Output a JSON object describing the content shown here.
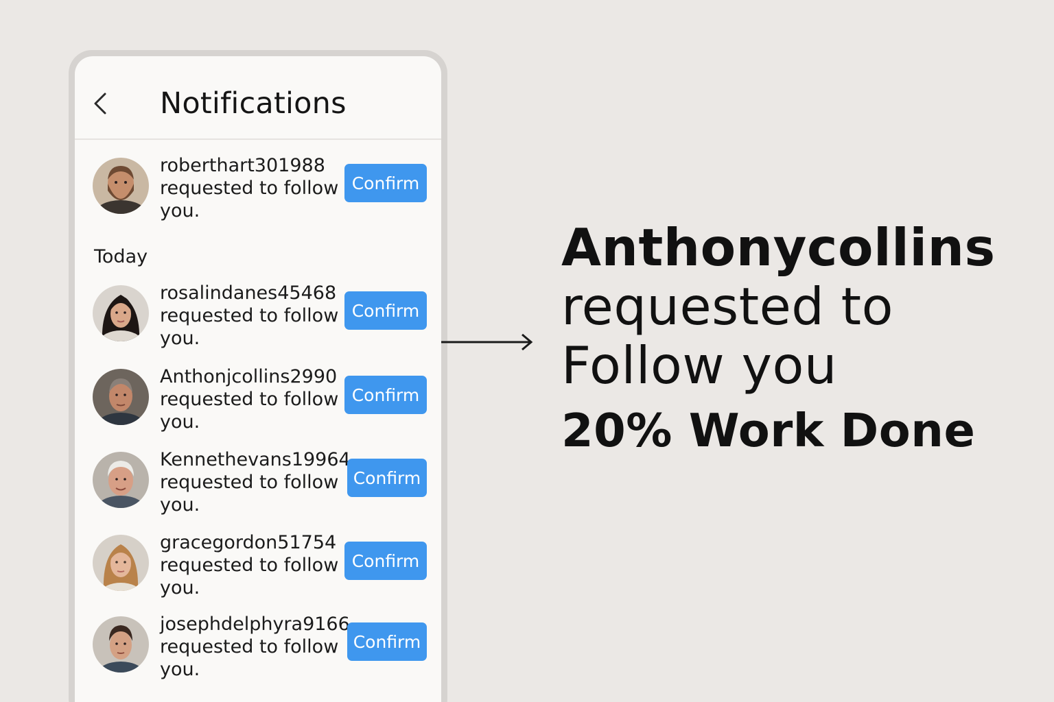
{
  "header": {
    "title": "Notifications",
    "back_icon": "chevron-left-icon"
  },
  "section_today_label": "Today",
  "notifications": [
    {
      "username": "roberthart301988",
      "message": "requested to follow you.",
      "button": "Confirm",
      "avatar": "bearded-man-avatar"
    },
    {
      "username": "rosalindanes45468",
      "message": "requested to follow you.",
      "button": "Confirm",
      "avatar": "young-woman-dark-hair-avatar"
    },
    {
      "username": "Anthonjcollins2990",
      "message": "requested to follow you.",
      "button": "Confirm",
      "avatar": "older-man-avatar"
    },
    {
      "username": "Kennethevans19964",
      "message": "requested to follow you.",
      "button": "Confirm",
      "avatar": "elderly-man-white-hair-avatar"
    },
    {
      "username": "gracegordon51754",
      "message": "requested to follow you.",
      "button": "Confirm",
      "avatar": "young-woman-blonde-avatar"
    },
    {
      "username": "josephdelphyra9166",
      "message": "requested to follow you.",
      "button": "Confirm",
      "avatar": "young-man-avatar"
    }
  ],
  "callout": {
    "line1": "Anthonycollins",
    "line2": "requested to",
    "line3": "Follow you",
    "progress": "20% Work Done",
    "progress_value": 0.2
  },
  "colors": {
    "background": "#ebe8e5",
    "confirm_button": "#3f97ee",
    "text": "#151515"
  }
}
